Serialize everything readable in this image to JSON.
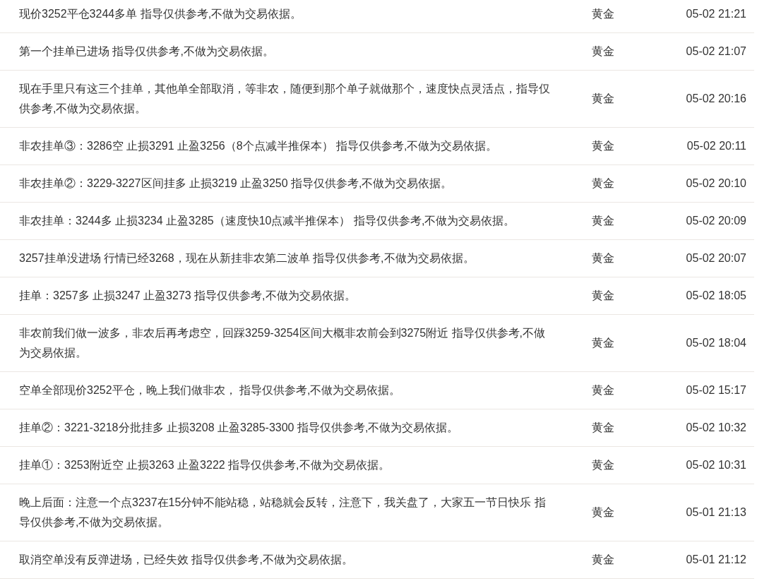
{
  "rows": [
    {
      "message": "现价3252平仓3244多单 指导仅供参考,不做为交易依据。",
      "category": "黄金",
      "time": "05-02 21:21"
    },
    {
      "message": "第一个挂单已进场 指导仅供参考,不做为交易依据。",
      "category": "黄金",
      "time": "05-02 21:07"
    },
    {
      "message": "现在手里只有这三个挂单，其他单全部取消，等非农，随便到那个单子就做那个，速度快点灵活点，指导仅供参考,不做为交易依据。",
      "category": "黄金",
      "time": "05-02 20:16"
    },
    {
      "message": "非农挂单③：3286空 止损3291 止盈3256（8个点减半推保本） 指导仅供参考,不做为交易依据。",
      "category": "黄金",
      "time": "05-02 20:11"
    },
    {
      "message": "非农挂单②：3229-3227区间挂多 止损3219 止盈3250 指导仅供参考,不做为交易依据。",
      "category": "黄金",
      "time": "05-02 20:10"
    },
    {
      "message": "非农挂单：3244多 止损3234 止盈3285（速度快10点减半推保本） 指导仅供参考,不做为交易依据。",
      "category": "黄金",
      "time": "05-02 20:09"
    },
    {
      "message": "3257挂单没进场 行情已经3268，现在从新挂非农第二波单 指导仅供参考,不做为交易依据。",
      "category": "黄金",
      "time": "05-02 20:07"
    },
    {
      "message": "挂单：3257多 止损3247 止盈3273 指导仅供参考,不做为交易依据。",
      "category": "黄金",
      "time": "05-02 18:05"
    },
    {
      "message": "非农前我们做一波多，非农后再考虑空，回踩3259-3254区间大概非农前会到3275附近 指导仅供参考,不做为交易依据。",
      "category": "黄金",
      "time": "05-02 18:04"
    },
    {
      "message": "空单全部现价3252平仓，晚上我们做非农， 指导仅供参考,不做为交易依据。",
      "category": "黄金",
      "time": "05-02 15:17"
    },
    {
      "message": "挂单②：3221-3218分批挂多 止损3208 止盈3285-3300 指导仅供参考,不做为交易依据。",
      "category": "黄金",
      "time": "05-02 10:32"
    },
    {
      "message": "挂单①：3253附近空 止损3263 止盈3222 指导仅供参考,不做为交易依据。",
      "category": "黄金",
      "time": "05-02 10:31"
    },
    {
      "message": "晚上后面：注意一个点3237在15分钟不能站稳，站稳就会反转，注意下，我关盘了，大家五一节日快乐 指导仅供参考,不做为交易依据。",
      "category": "黄金",
      "time": "05-01 21:13"
    },
    {
      "message": "取消空单没有反弹进场，已经失效 指导仅供参考,不做为交易依据。",
      "category": "黄金",
      "time": "05-01 21:12"
    }
  ]
}
